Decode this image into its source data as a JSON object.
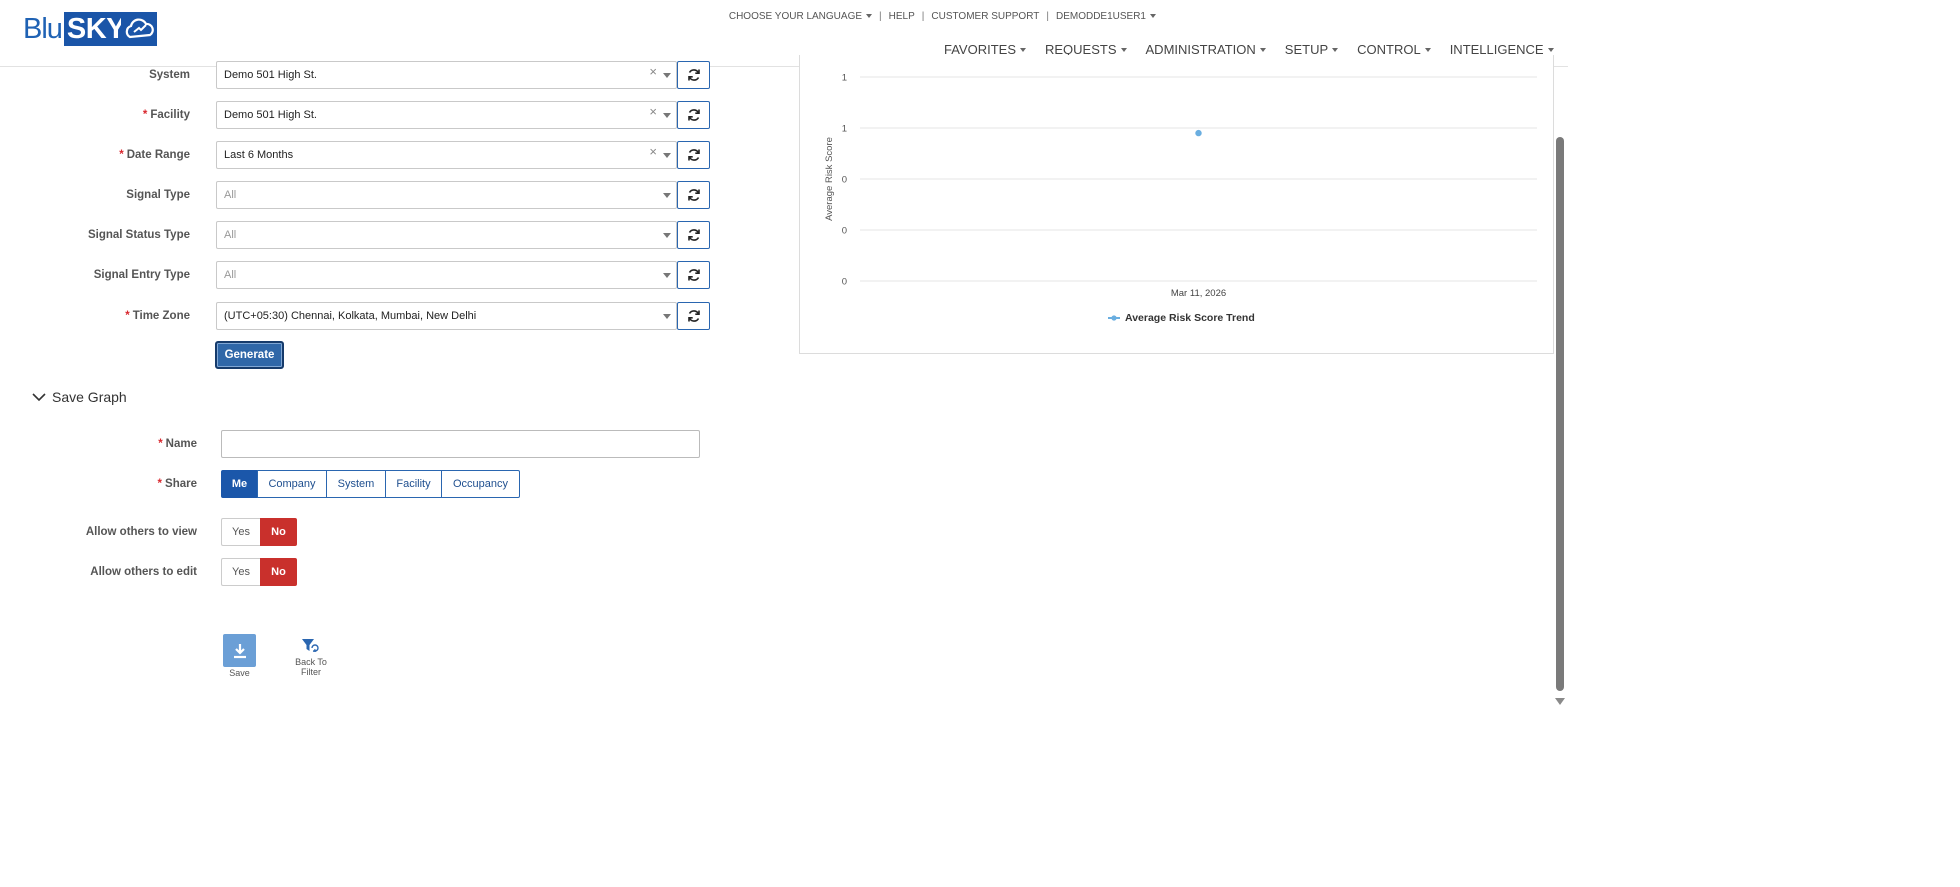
{
  "brand": {
    "part1": "Blu",
    "part2": "SKY"
  },
  "toplinks": {
    "language": "CHOOSE YOUR LANGUAGE",
    "help": "HELP",
    "support": "CUSTOMER SUPPORT",
    "user": "DEMODDE1USER1"
  },
  "nav": [
    "FAVORITES",
    "REQUESTS",
    "ADMINISTRATION",
    "SETUP",
    "CONTROL",
    "INTELLIGENCE"
  ],
  "filters": [
    {
      "label": "System",
      "required": false,
      "value": "Demo 501 High St.",
      "placeholder": false,
      "clearable": true
    },
    {
      "label": "Facility",
      "required": true,
      "value": "Demo 501 High St.",
      "placeholder": false,
      "clearable": true
    },
    {
      "label": "Date Range",
      "required": true,
      "value": "Last 6 Months",
      "placeholder": false,
      "clearable": true
    },
    {
      "label": "Signal Type",
      "required": false,
      "value": "All",
      "placeholder": true,
      "clearable": false
    },
    {
      "label": "Signal Status Type",
      "required": false,
      "value": "All",
      "placeholder": true,
      "clearable": false
    },
    {
      "label": "Signal Entry Type",
      "required": false,
      "value": "All",
      "placeholder": true,
      "clearable": false
    },
    {
      "label": "Time Zone",
      "required": true,
      "value": "(UTC+05:30) Chennai, Kolkata, Mumbai, New Delhi",
      "placeholder": false,
      "clearable": false
    }
  ],
  "generate_label": "Generate",
  "save_graph": {
    "title": "Save Graph",
    "name_label": "Name",
    "name_value": "",
    "share_label": "Share",
    "share_options": [
      "Me",
      "Company",
      "System",
      "Facility",
      "Occupancy"
    ],
    "share_selected": "Me",
    "allow_view_label": "Allow others to view",
    "allow_edit_label": "Allow others to edit",
    "yes_label": "Yes",
    "no_label": "No",
    "save_label": "Save",
    "back_label_1": "Back To",
    "back_label_2": "Filter"
  },
  "chart_data": {
    "type": "line",
    "ylabel": "Average Risk Score",
    "xlabel": "",
    "y_tick_labels": [
      "1",
      "1",
      "0",
      "0",
      "0"
    ],
    "x": [
      "Mar 11, 2026"
    ],
    "series": [
      {
        "name": "Average Risk Score Trend",
        "values": [
          0.87
        ]
      }
    ],
    "ylim": [
      0,
      1.2
    ],
    "grid": true,
    "legend": "bottom-center",
    "series_color": "#6aaee0"
  }
}
